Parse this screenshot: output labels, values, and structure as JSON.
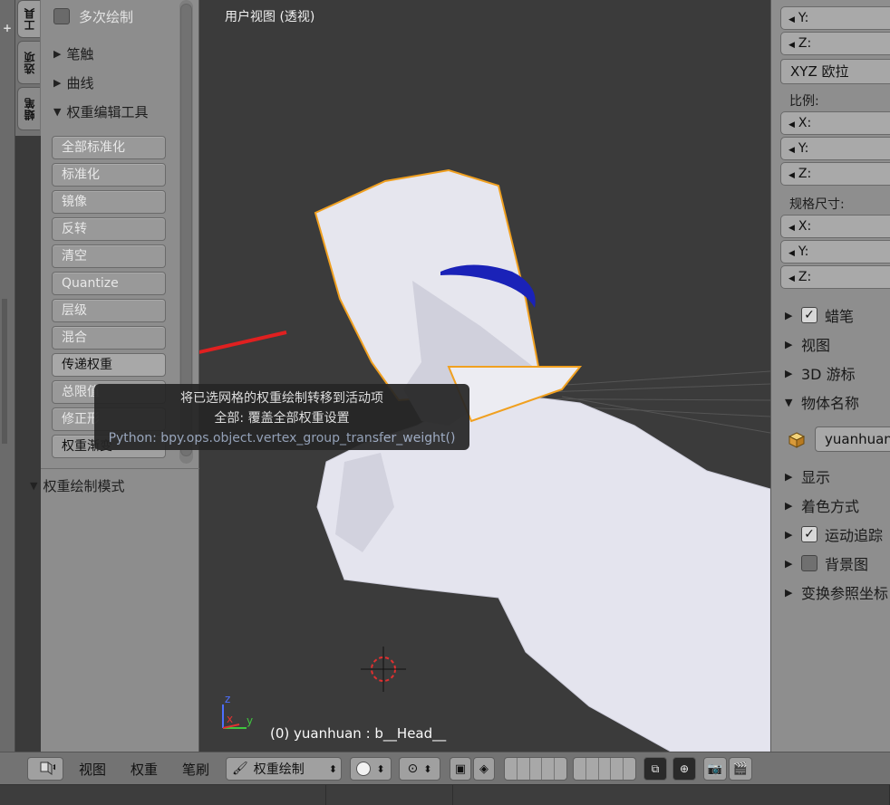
{
  "tool_tabs": [
    "工具",
    "选项",
    "蜡笔"
  ],
  "tool_shelf": {
    "multi_paint_label": "多次绘制",
    "sections": [
      "笔触",
      "曲线",
      "权重编辑工具"
    ],
    "buttons": [
      "全部标准化",
      "标准化",
      "镜像",
      "反转",
      "清空",
      "Quantize",
      "层级",
      "混合",
      "传递权重",
      "总限值",
      "修正形",
      "权重渐变"
    ],
    "panel_bottom": "权重绘制模式"
  },
  "viewport": {
    "title": "用户视图 (透视)",
    "status": "(0) yuanhuan : b__Head__",
    "axis_x": "x",
    "axis_y": "y",
    "axis_z": "z"
  },
  "tooltip": {
    "line1": "将已选网格的权重绘制转移到活动项",
    "line2": "全部: 覆盖全部权重设置",
    "line3": "Python: bpy.ops.object.vertex_group_transfer_weight()"
  },
  "properties": {
    "rotation_y": "Y:",
    "rotation_z": "Z:",
    "rotation_mode": "XYZ 欧拉",
    "scale_label": "比例:",
    "scale_x": "X:",
    "scale_y": "Y:",
    "scale_z": "Z:",
    "dims_label": "规格尺寸:",
    "dims_x": "X:",
    "dims_y": "Y:",
    "dims_z": "Z:",
    "panels": [
      {
        "label": "蜡笔",
        "checkbox": true,
        "checked": true
      },
      {
        "label": "视图"
      },
      {
        "label": "3D 游标"
      },
      {
        "label": "物体名称",
        "expanded": true
      },
      {
        "label": "显示"
      },
      {
        "label": "着色方式"
      },
      {
        "label": "运动追踪",
        "checkbox": true,
        "checked": true
      },
      {
        "label": "背景图",
        "checkbox": true,
        "checked": false
      },
      {
        "label": "变换参照坐标"
      }
    ],
    "object_name": "yuanhuan"
  },
  "header": {
    "menus": [
      "视图",
      "权重",
      "笔刷"
    ],
    "mode": "权重绘制"
  },
  "colors": {
    "viewport_bg": "#3b3b3b",
    "panel_bg": "#8d8d8d",
    "selection_outline": "#f0a020",
    "ring_blue": "#1a22b8",
    "arrow_red": "#e02020"
  }
}
